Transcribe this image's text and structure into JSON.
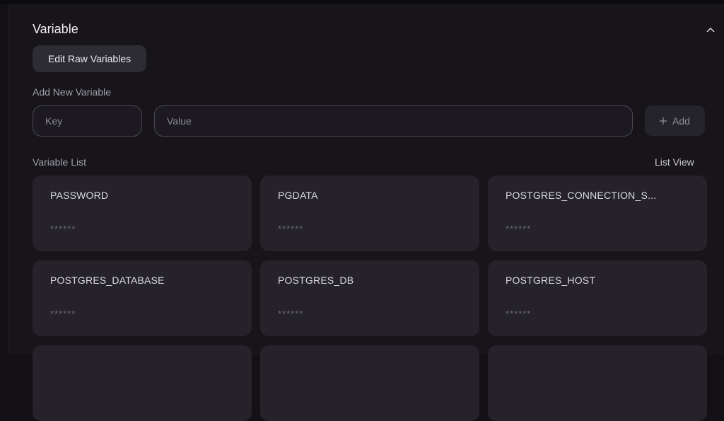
{
  "section": {
    "title": "Variable",
    "raw_button_label": "Edit Raw Variables"
  },
  "add_new": {
    "label": "Add New Variable",
    "key_placeholder": "Key",
    "value_placeholder": "Value",
    "add_label": "Add"
  },
  "variable_list": {
    "label": "Variable List",
    "view_toggle_label": "List View",
    "items": [
      {
        "key": "PASSWORD",
        "value": "******"
      },
      {
        "key": "PGDATA",
        "value": "******"
      },
      {
        "key": "POSTGRES_CONNECTION_S...",
        "value": "******"
      },
      {
        "key": "POSTGRES_DATABASE",
        "value": "******"
      },
      {
        "key": "POSTGRES_DB",
        "value": "******"
      },
      {
        "key": "POSTGRES_HOST",
        "value": "******"
      }
    ]
  },
  "icons": {
    "collapse": "chevron-up-icon",
    "add": "plus-icon"
  },
  "colors": {
    "background": "#131116",
    "panel": "#17151a",
    "card": "#252329",
    "button": "#2e2c33"
  }
}
